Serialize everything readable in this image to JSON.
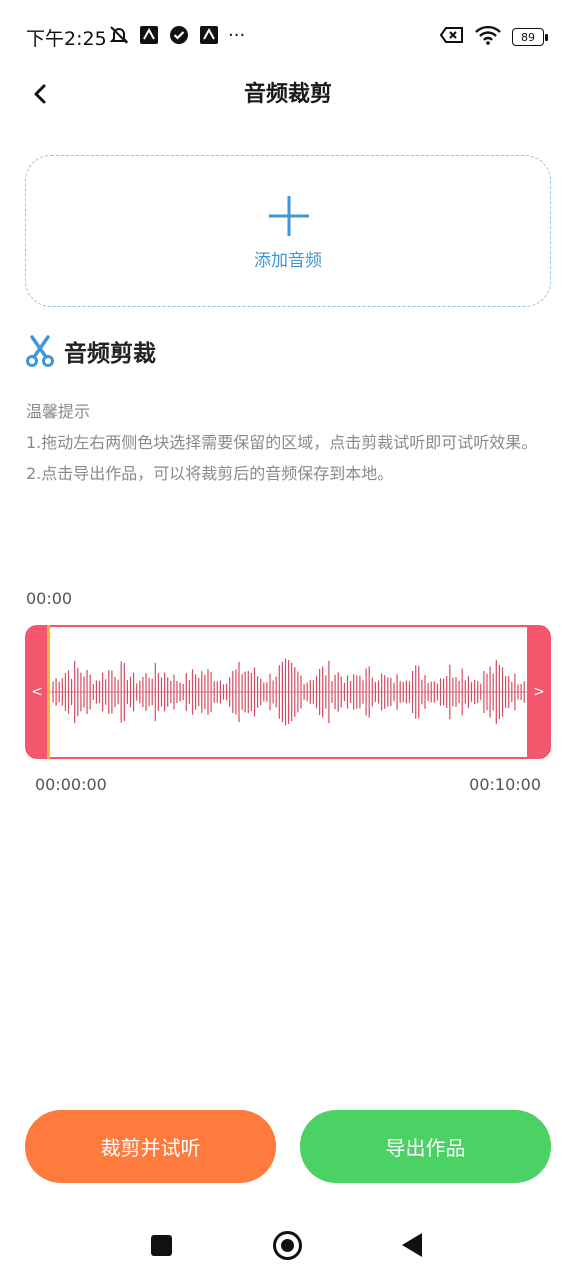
{
  "status_bar": {
    "time": "下午2:25",
    "more": "···",
    "battery": "89",
    "icons": [
      "mute-icon",
      "app-notification-icon",
      "check-circle-icon",
      "app-notification-icon",
      "sim-blocked-icon",
      "wifi-icon",
      "battery-icon"
    ]
  },
  "header": {
    "title": "音频裁剪",
    "back_icon": "chevron-left-icon"
  },
  "upload": {
    "label": "添加音频",
    "icon": "plus-icon",
    "accent_color": "#3e97d6"
  },
  "section": {
    "title": "音频剪裁",
    "icon": "scissors-icon"
  },
  "tips": {
    "heading": "温馨提示",
    "line1": "1.拖动左右两侧色块选择需要保留的区域，点击剪裁试听即可试听效果。",
    "line2": "2.点击导出作品，可以将裁剪后的音频保存到本地。"
  },
  "editor": {
    "current_time": "00:00",
    "start_time": "00:00:00",
    "end_time": "00:10:00",
    "left_handle": "<",
    "right_handle": ">",
    "handle_color": "#f4566e",
    "playhead_color": "#f2b33c",
    "wave_color": "#d64b62"
  },
  "actions": {
    "trim_label": "裁剪并试听",
    "export_label": "导出作品",
    "trim_color": "#ff7a3d",
    "export_color": "#4cd264"
  }
}
